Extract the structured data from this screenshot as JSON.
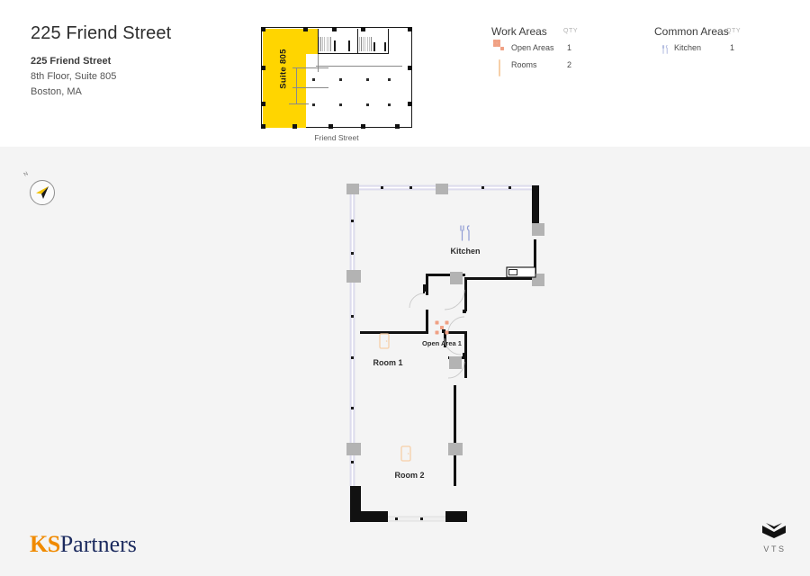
{
  "header": {
    "title": "225 Friend Street",
    "address_name": "225 Friend Street",
    "address_line2": "8th Floor, Suite 805",
    "address_line3": "Boston, MA"
  },
  "keyplan": {
    "suite_label": "Suite 805",
    "street_label": "Friend Street",
    "highlight_color": "#ffd500"
  },
  "compass": {
    "north_label": "N"
  },
  "legend": {
    "work_areas": {
      "title": "Work Areas",
      "qty_header": "QTY",
      "rows": [
        {
          "icon": "open-areas-icon",
          "label": "Open Areas",
          "qty": "1"
        },
        {
          "icon": "rooms-icon",
          "label": "Rooms",
          "qty": "2"
        }
      ]
    },
    "common_areas": {
      "title": "Common Areas",
      "qty_header": "QTY",
      "rows": [
        {
          "icon": "kitchen-icon",
          "label": "Kitchen",
          "qty": "1"
        }
      ]
    }
  },
  "floorplan": {
    "spaces": [
      {
        "name": "Kitchen",
        "icon": "kitchen-icon"
      },
      {
        "name": "Open Area 1",
        "icon": "open-areas-icon"
      },
      {
        "name": "Room 1",
        "icon": "rooms-icon"
      },
      {
        "name": "Room 2",
        "icon": "rooms-icon"
      }
    ],
    "colors": {
      "wall": "#111111",
      "window": "#e2e1f0",
      "column": "#b3b3b3",
      "open_area_icon": "#f0a184",
      "room_icon": "#f6cfa8",
      "kitchen_icon": "#8f9cd4"
    }
  },
  "footer": {
    "brand_ks": "KS",
    "brand_partners": "Partners",
    "vts_text": "VTS"
  }
}
